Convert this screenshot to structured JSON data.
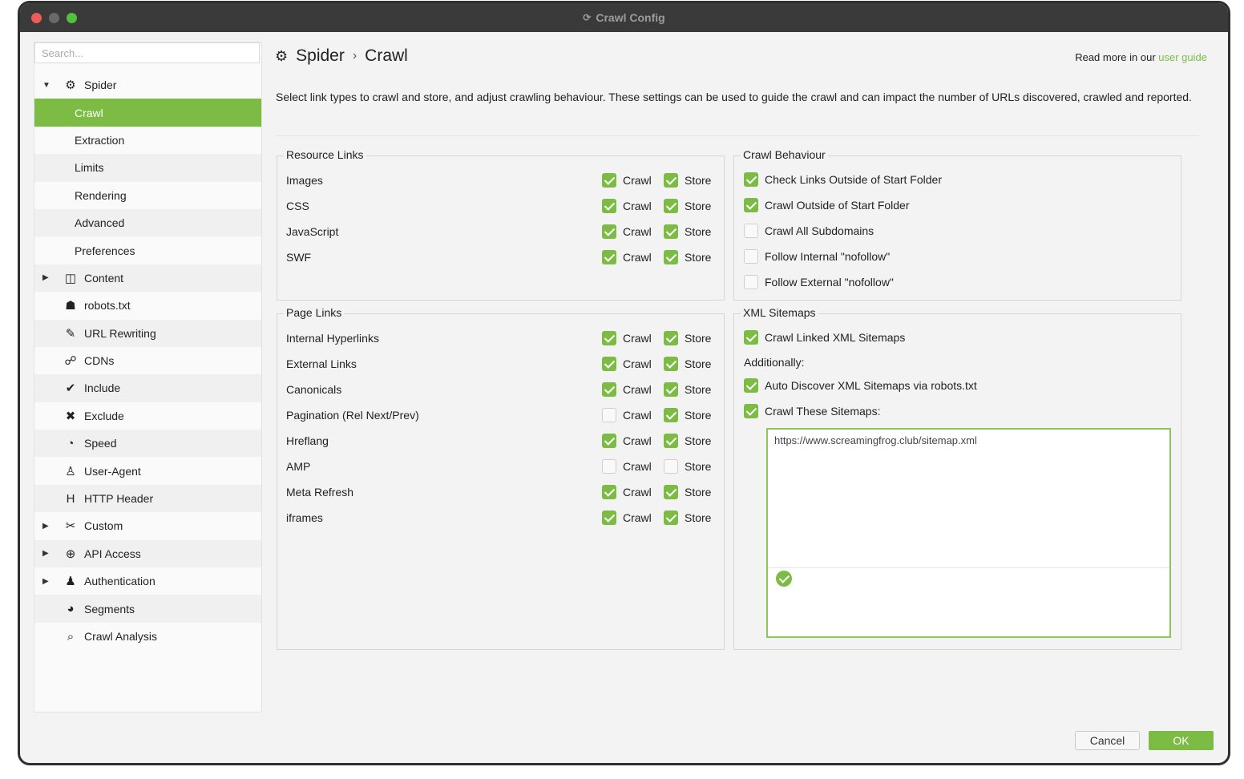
{
  "window": {
    "title": "Crawl Config"
  },
  "sidebar": {
    "search_placeholder": "Search...",
    "items": [
      {
        "label": "Spider",
        "icon": "gear-icon",
        "arrow": "▼"
      },
      {
        "label": "Crawl",
        "active": true
      },
      {
        "label": "Extraction"
      },
      {
        "label": "Limits"
      },
      {
        "label": "Rendering"
      },
      {
        "label": "Advanced"
      },
      {
        "label": "Preferences"
      },
      {
        "label": "Content",
        "icon": "columns-icon",
        "arrow": "▶"
      },
      {
        "label": "robots.txt",
        "icon": "robot-icon"
      },
      {
        "label": "URL Rewriting",
        "icon": "edit-icon"
      },
      {
        "label": "CDNs",
        "icon": "network-icon"
      },
      {
        "label": "Include",
        "icon": "check-circle-icon"
      },
      {
        "label": "Exclude",
        "icon": "x-circle-icon"
      },
      {
        "label": "Speed",
        "icon": "speedometer-icon"
      },
      {
        "label": "User-Agent",
        "icon": "user-agent-icon"
      },
      {
        "label": "HTTP Header",
        "icon": "h-icon"
      },
      {
        "label": "Custom",
        "icon": "tools-icon",
        "arrow": "▶"
      },
      {
        "label": "API Access",
        "icon": "globe-icon",
        "arrow": "▶"
      },
      {
        "label": "Authentication",
        "icon": "users-icon",
        "arrow": "▶"
      },
      {
        "label": "Segments",
        "icon": "pie-chart-icon"
      },
      {
        "label": "Crawl Analysis",
        "icon": "search-icon"
      }
    ]
  },
  "header": {
    "breadcrumb_parent": "Spider",
    "breadcrumb_separator": "›",
    "breadcrumb_current": "Crawl",
    "read_more_prefix": "Read more in our",
    "read_more_link": "user guide",
    "description": "Select link types to crawl and store, and adjust crawling behaviour. These settings can be used to guide the crawl and can impact the number of URLs discovered, crawled and reported."
  },
  "labels": {
    "crawl": "Crawl",
    "store": "Store"
  },
  "resource_links": {
    "title": "Resource Links",
    "rows": [
      {
        "label": "Images",
        "crawl": true,
        "store": true
      },
      {
        "label": "CSS",
        "crawl": true,
        "store": true
      },
      {
        "label": "JavaScript",
        "crawl": true,
        "store": true
      },
      {
        "label": "SWF",
        "crawl": true,
        "store": true
      }
    ]
  },
  "page_links": {
    "title": "Page Links",
    "rows": [
      {
        "label": "Internal Hyperlinks",
        "crawl": true,
        "store": true
      },
      {
        "label": "External Links",
        "crawl": true,
        "store": true
      },
      {
        "label": "Canonicals",
        "crawl": true,
        "store": true
      },
      {
        "label": "Pagination (Rel Next/Prev)",
        "crawl": false,
        "store": true
      },
      {
        "label": "Hreflang",
        "crawl": true,
        "store": true
      },
      {
        "label": "AMP",
        "crawl": false,
        "store": false
      },
      {
        "label": "Meta Refresh",
        "crawl": true,
        "store": true
      },
      {
        "label": "iframes",
        "crawl": true,
        "store": true
      }
    ]
  },
  "crawl_behaviour": {
    "title": "Crawl Behaviour",
    "options": [
      {
        "label": "Check Links Outside of Start Folder",
        "checked": true
      },
      {
        "label": "Crawl Outside of Start Folder",
        "checked": true
      },
      {
        "label": "Crawl All Subdomains",
        "checked": false
      },
      {
        "label": "Follow Internal \"nofollow\"",
        "checked": false
      },
      {
        "label": "Follow External \"nofollow\"",
        "checked": false
      }
    ]
  },
  "xml_sitemaps": {
    "title": "XML Sitemaps",
    "crawl_linked": {
      "label": "Crawl Linked XML Sitemaps",
      "checked": true
    },
    "additionally": "Additionally:",
    "auto_discover": {
      "label": "Auto Discover XML Sitemaps via robots.txt",
      "checked": true
    },
    "crawl_these": {
      "label": "Crawl These Sitemaps:",
      "checked": true
    },
    "sitemap_urls": "https://www.screamingfrog.club/sitemap.xml"
  },
  "footer": {
    "cancel_label": "Cancel",
    "ok_label": "OK"
  },
  "colors": {
    "accent": "#7cbc44",
    "titlebar": "#3a3a3a"
  }
}
